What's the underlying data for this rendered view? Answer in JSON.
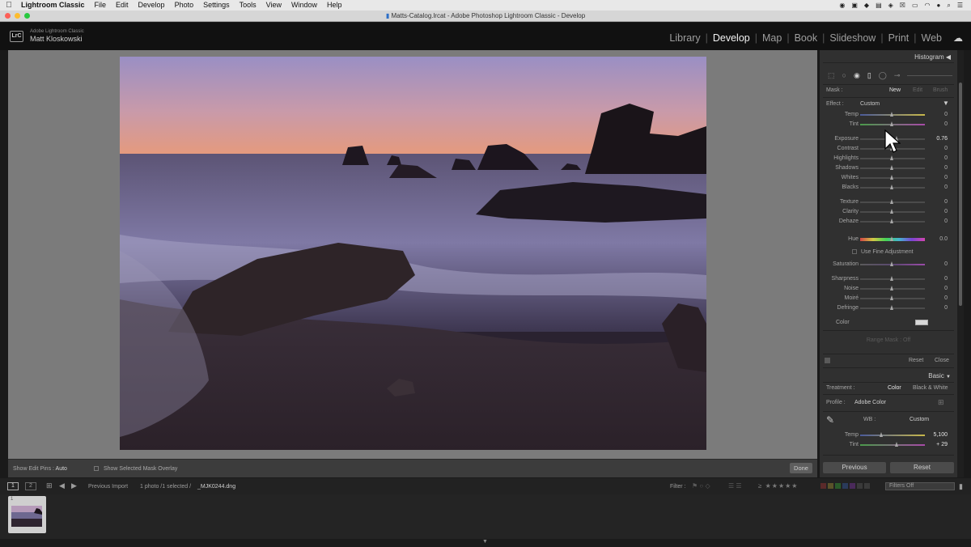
{
  "menubar": {
    "app": "Lightroom Classic",
    "items": [
      "File",
      "Edit",
      "Develop",
      "Photo",
      "Settings",
      "Tools",
      "View",
      "Window",
      "Help"
    ]
  },
  "window": {
    "title": "Matts-Catalog.lrcat - Adobe Photoshop Lightroom Classic - Develop"
  },
  "identity": {
    "product": "Adobe Lightroom Classic",
    "user": "Matt Kloskowski",
    "logo": "LrC"
  },
  "modules": [
    "Library",
    "Develop",
    "Map",
    "Book",
    "Slideshow",
    "Print",
    "Web"
  ],
  "active_module": "Develop",
  "toolbar": {
    "edit_pins_label": "Show Edit Pins :",
    "edit_pins_value": "Auto",
    "mask_overlay_label": "Show Selected Mask Overlay",
    "done": "Done"
  },
  "panel": {
    "histogram": "Histogram",
    "mask_label": "Mask :",
    "mask_new": "New",
    "mask_edit": "Edit",
    "mask_brush": "Brush",
    "effect_label": "Effect :",
    "effect_value": "Custom",
    "sliders_a": [
      {
        "label": "Temp",
        "value": "0"
      },
      {
        "label": "Tint",
        "value": "0"
      }
    ],
    "sliders_b": [
      {
        "label": "Exposure",
        "value": "0.76"
      },
      {
        "label": "Contrast",
        "value": "0"
      },
      {
        "label": "Highlights",
        "value": "0"
      },
      {
        "label": "Shadows",
        "value": "0"
      },
      {
        "label": "Whites",
        "value": "0"
      },
      {
        "label": "Blacks",
        "value": "0"
      }
    ],
    "sliders_c": [
      {
        "label": "Texture",
        "value": "0"
      },
      {
        "label": "Clarity",
        "value": "0"
      },
      {
        "label": "Dehaze",
        "value": "0"
      }
    ],
    "hue": {
      "label": "Hue",
      "value": "0.0"
    },
    "fine_adjust": "Use Fine Adjustment",
    "saturation": {
      "label": "Saturation",
      "value": "0"
    },
    "sliders_d": [
      {
        "label": "Sharpness",
        "value": "0"
      },
      {
        "label": "Noise",
        "value": "0"
      },
      {
        "label": "Moiré",
        "value": "0"
      },
      {
        "label": "Defringe",
        "value": "0"
      }
    ],
    "color_label": "Color",
    "range_mask": "Range Mask : Off",
    "reset": "Reset",
    "close": "Close",
    "basic": "Basic",
    "treatment_label": "Treatment :",
    "treatment_color": "Color",
    "treatment_bw": "Black & White",
    "profile_label": "Profile :",
    "profile_value": "Adobe Color",
    "wb_label": "WB :",
    "wb_value": "Custom",
    "basic_temp": {
      "label": "Temp",
      "value": "5,100"
    },
    "basic_tint": {
      "label": "Tint",
      "value": "+ 29"
    },
    "previous": "Previous",
    "reset_btn": "Reset"
  },
  "filmstrip": {
    "page1": "1",
    "page2": "2",
    "source": "Previous Import",
    "count": "1 photo /1 selected /",
    "filename": "_MJK0244.dng",
    "filter_label": "Filter :",
    "filters_off": "Filters Off",
    "thumb_index": "1"
  }
}
